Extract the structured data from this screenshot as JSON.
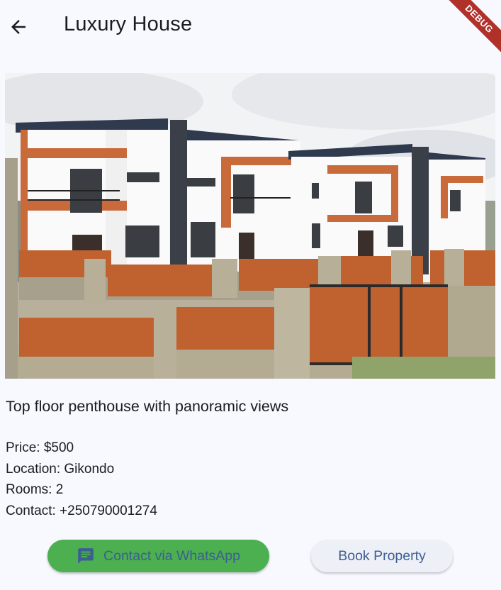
{
  "appbar": {
    "title": "Luxury House",
    "back_icon": "arrow-back-icon",
    "debug_label": "DEBUG"
  },
  "property": {
    "image_alt": "Row of two-storey white houses with orange brick accents and wooden fence gates",
    "description": "Top floor penthouse with panoramic views",
    "price": "Price: $500",
    "location": "Location: Gikondo",
    "rooms": "Rooms: 2",
    "contact": "Contact: +250790001274"
  },
  "actions": {
    "whatsapp_label": "Contact via WhatsApp",
    "whatsapp_icon": "chat-bubble-icon",
    "book_label": "Book Property"
  },
  "colors": {
    "background": "#f8f9ff",
    "whatsapp_button": "#4caf50",
    "button_text": "#3c5f92",
    "debug_ribbon": "#b0302a"
  }
}
